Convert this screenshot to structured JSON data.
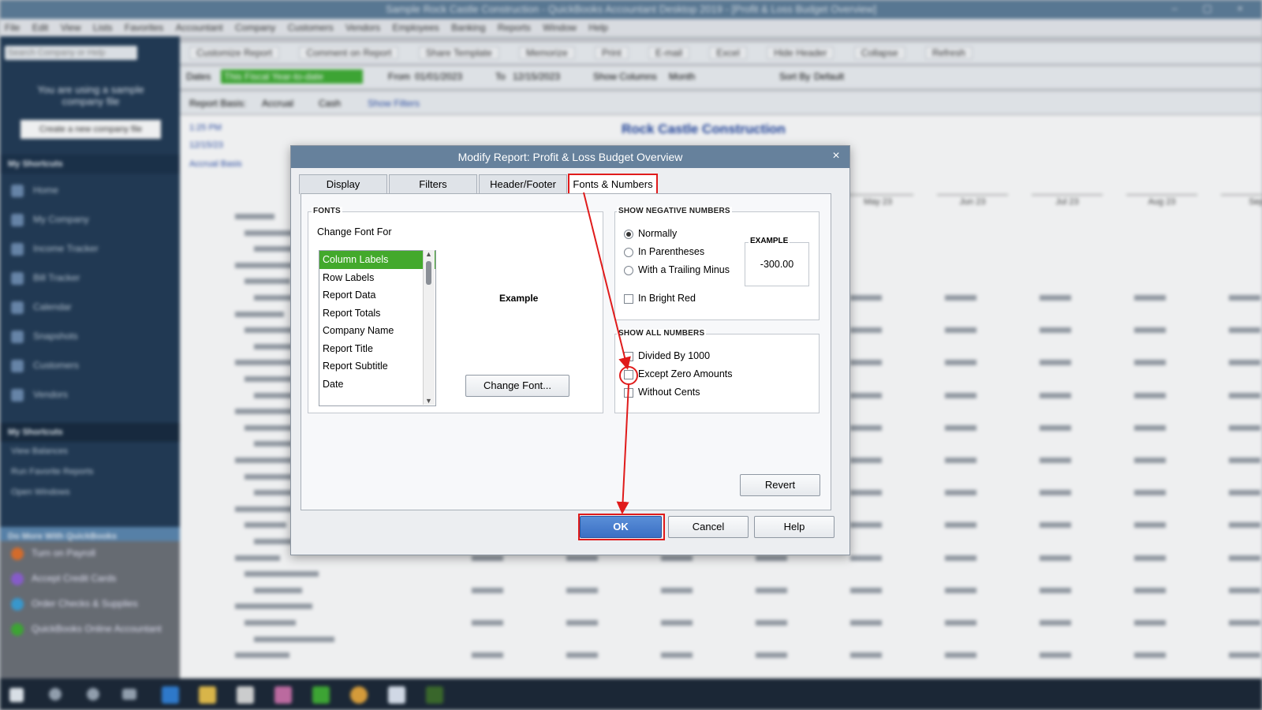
{
  "app": {
    "title": "Sample Rock Castle Construction - QuickBooks Accountant Desktop 2019 - [Profit & Loss Budget Overview]",
    "menu": [
      "File",
      "Edit",
      "View",
      "Lists",
      "Favorites",
      "Accountant",
      "Company",
      "Customers",
      "Vendors",
      "Employees",
      "Banking",
      "Reports",
      "Window",
      "Help"
    ],
    "search_placeholder": "Search Company or Help",
    "sample_msg": "You are using a sample company file",
    "create_company": "Create a new company file",
    "my_shortcuts_header": "My Shortcuts",
    "shortcuts": [
      "Home",
      "My Company",
      "Income Tracker",
      "Bill Tracker",
      "Calendar",
      "Snapshots",
      "Customers",
      "Vendors"
    ],
    "lower_links": [
      "My Shortcuts",
      "View Balances",
      "Run Favorite Reports",
      "Open Windows"
    ],
    "do_more_header": "Do More With QuickBooks",
    "do_more": [
      "Turn on Payroll",
      "Accept Credit Cards",
      "Order Checks & Supplies",
      "QuickBooks Online Accountant"
    ],
    "toolbar": [
      "Customize Report",
      "Comment on Report",
      "Share Template",
      "Memorize",
      "Print",
      "E-mail",
      "Excel",
      "Hide Header",
      "Collapse",
      "Refresh"
    ],
    "filter": {
      "dates_label": "Dates",
      "dates_value": "This Fiscal Year-to-date",
      "from_label": "From",
      "from_value": "01/01/2023",
      "to_label": "To",
      "to_value": "12/15/2023",
      "columns_label": "Show Columns",
      "columns_value": "Month",
      "sort_label": "Sort By",
      "sort_value": "Default"
    },
    "basis": {
      "label": "Report Basis:",
      "accrual": "Accrual",
      "cash": "Cash",
      "show_filters": "Show Filters"
    },
    "report": {
      "company": "Rock Castle Construction",
      "time": "1:25 PM",
      "date": "12/15/23",
      "basis": "Accrual Basis",
      "months": [
        "May 23",
        "Jun 23",
        "Jul 23",
        "Aug 23",
        "Sep"
      ]
    }
  },
  "dialog": {
    "title": "Modify Report: Profit & Loss Budget Overview",
    "close_glyph": "×",
    "tabs": [
      "Display",
      "Filters",
      "Header/Footer",
      "Fonts & Numbers"
    ],
    "active_tab": "Fonts & Numbers",
    "fonts": {
      "group_title": "FONTS",
      "change_font_for": "Change Font For",
      "items": [
        "Column Labels",
        "Row Labels",
        "Report Data",
        "Report Totals",
        "Company Name",
        "Report Title",
        "Report Subtitle",
        "Date"
      ],
      "selected": "Column Labels",
      "example_label": "Example",
      "change_font_button": "Change Font..."
    },
    "negative": {
      "group_title": "SHOW NEGATIVE NUMBERS",
      "options": [
        "Normally",
        "In Parentheses",
        "With a Trailing Minus"
      ],
      "selected": "Normally",
      "bright_red": "In Bright Red",
      "example_title": "EXAMPLE",
      "example_value": "-300.00"
    },
    "all_numbers": {
      "group_title": "SHOW ALL NUMBERS",
      "options": [
        "Divided By 1000",
        "Except Zero Amounts",
        "Without Cents"
      ]
    },
    "buttons": {
      "revert": "Revert",
      "ok": "OK",
      "cancel": "Cancel",
      "help": "Help"
    }
  },
  "colors": {
    "accent_red": "#e01b1b",
    "selection_green": "#43a92c",
    "ok_blue": "#3b6fc4",
    "sidebar": "#213a55"
  }
}
